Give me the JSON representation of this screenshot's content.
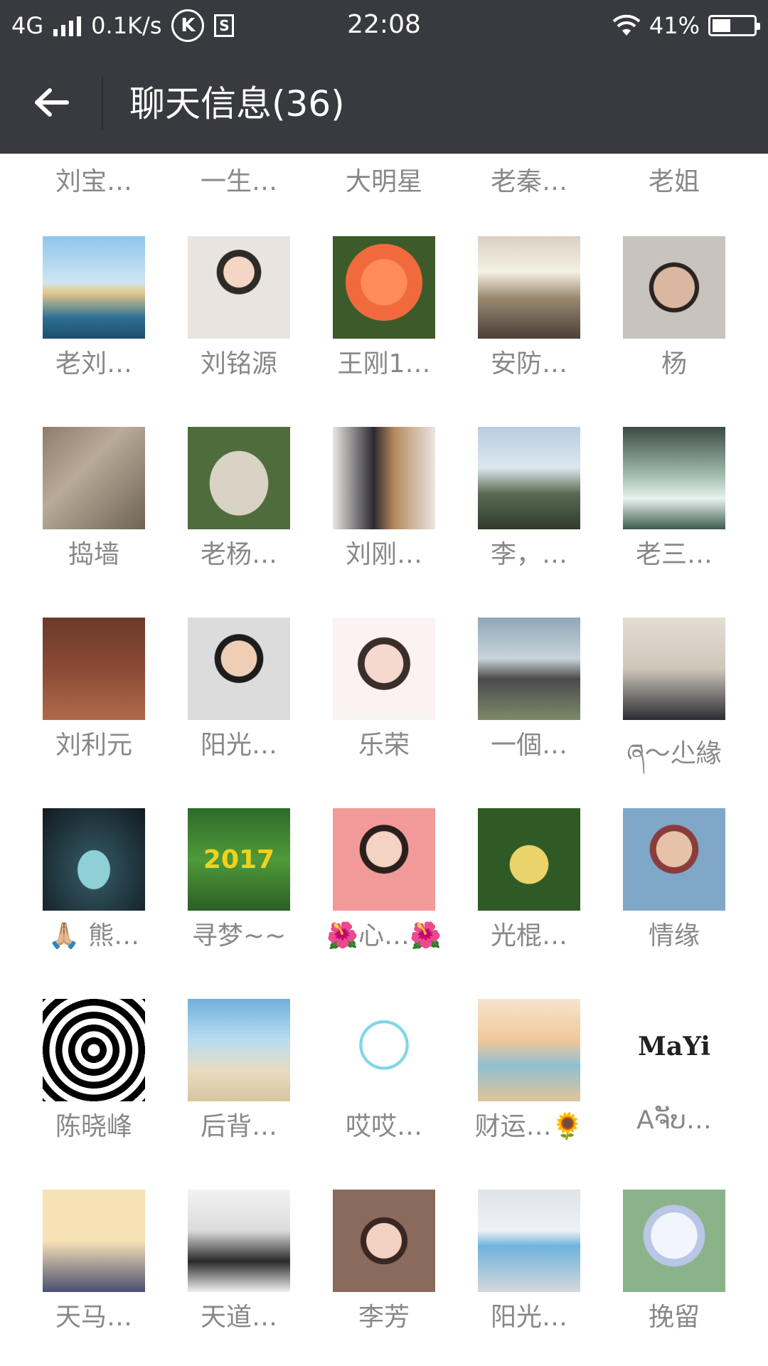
{
  "status_bar": {
    "network": "4G",
    "speed": "0.1K/s",
    "k_icon": "K",
    "s_icon": "S",
    "time": "22:08",
    "battery": "41%",
    "battery_level": 0.41
  },
  "header": {
    "back_icon": "arrow-left-icon",
    "title": "聊天信息(36)"
  },
  "members": [
    {
      "name": "刘宝…",
      "avatar": ""
    },
    {
      "name": "一生…",
      "avatar": ""
    },
    {
      "name": "大明星",
      "avatar": ""
    },
    {
      "name": "老秦…",
      "avatar": ""
    },
    {
      "name": "老姐",
      "avatar": ""
    },
    {
      "name": "老刘…",
      "avatar": "sailing-ship",
      "bg": "linear-gradient(#8fc6ec 0%,#cfe5f3 45%,#e6c98a 55%,#2a6f96 80%,#204e6a 100%)"
    },
    {
      "name": "刘铭源",
      "avatar": "person-photo",
      "bg": "radial-gradient(circle at 50% 35%,#f3d7c4 0 18%,#2d2a28 19% 26%,#e9e4df 27%)"
    },
    {
      "name": "王刚1…",
      "avatar": "orange-flower",
      "bg": "radial-gradient(circle at 50% 45%,#ff8a5a 0 30%,#f06a3e 31% 50%,#3c5a2a 51%)"
    },
    {
      "name": "安防…",
      "avatar": "office-room",
      "bg": "linear-gradient(#d9d2c3 0%,#f5f0e4 35%,#9b8a72 60%,#4a4038 100%)"
    },
    {
      "name": "杨",
      "avatar": "person-photo",
      "bg": "radial-gradient(circle at 50% 50%,#d9b7a1 0 28%,#2a2320 29% 34%,#c9c3bd 35%)"
    },
    {
      "name": "捣墙",
      "avatar": "rock",
      "bg": "linear-gradient(135deg,#8d7d6c,#b9ab98 40%,#6e6356 100%)"
    },
    {
      "name": "老杨…",
      "avatar": "stone-inscription",
      "bg": "radial-gradient(ellipse at 50% 55%,#d8d3c5 0 40%,#4f6c3d 41%)"
    },
    {
      "name": "刘刚…",
      "avatar": "person-photo",
      "bg": "linear-gradient(90deg,#e9e6e3 0%,#2c2b30 40%,#b7895e 60%,#e9e6e3 100%)"
    },
    {
      "name": "李，…",
      "avatar": "mountains",
      "bg": "linear-gradient(#b9cde3 0%,#dde6ef 40%,#5b6b52 65%,#2f3b2d 100%)"
    },
    {
      "name": "老三…",
      "avatar": "horse-waterfall",
      "bg": "linear-gradient(#3c4a44 0%,#a8c3b6 50%,#e9f2ee 70%,#3e5c4e 100%)"
    },
    {
      "name": "刘利元",
      "avatar": "person-photo",
      "bg": "linear-gradient(#6b3a2a 0%,#8a4a35 50%,#b06a4a 100%)"
    },
    {
      "name": "阳光…",
      "avatar": "person-photo",
      "bg": "radial-gradient(circle at 50% 40%,#f0cdb5 0 22%,#1c1c1c 23% 30%,#dcdcdc 31%)"
    },
    {
      "name": "乐荣",
      "avatar": "person-photo",
      "bg": "radial-gradient(circle at 50% 45%,#f6d9ce 0 25%,#3b2d2a 26% 34%,#fbf3f3 35%)"
    },
    {
      "name": "一個…",
      "avatar": "motorcycle",
      "bg": "linear-gradient(#8fa7b6 0%,#c9d4d9 40%,#4a4a4a 60%,#7d8a6a 100%)"
    },
    {
      "name": "ཞ〜尐緣",
      "avatar": "person-photo",
      "bg": "linear-gradient(#e4ddd3 0%,#cfc6ba 50%,#2b2b33 100%)"
    },
    {
      "name": "🙏🏼 熊…",
      "avatar": "spotlight",
      "bg": "radial-gradient(ellipse at 50% 60%,#8ed0d6 0 22%,#2e4d58 23%,#111a1e 100%)"
    },
    {
      "name": "寻梦~~",
      "avatar": "grass-2017",
      "bg": "linear-gradient(#2d6a2a 0%,#4f9a3a 50%,#2c5e25 100%)",
      "text": "2017"
    },
    {
      "name": "🌺心…🌺",
      "avatar": "person-photo",
      "bg": "radial-gradient(circle at 50% 40%,#f4d3c3 0 22%,#2a1f1c 23% 30%,#f29a9a 31%)"
    },
    {
      "name": "光棍…",
      "avatar": "buddha-fruit",
      "bg": "radial-gradient(circle at 50% 55%,#e9d36a 0 25%,#2f5a25 26%)"
    },
    {
      "name": "情缘",
      "avatar": "baby-photo",
      "bg": "radial-gradient(circle at 50% 40%,#e6c2a8 0 22%,#8a3b3b 23% 30%,#7fa7c8 31%)"
    },
    {
      "name": "陈晓峰",
      "avatar": "swirl",
      "bg": "repeating-radial-gradient(circle at 50% 50%,#ffffff 0 8px,#000000 9px 18px)"
    },
    {
      "name": "后背…",
      "avatar": "beach-person",
      "bg": "linear-gradient(#6fb0de 0%,#b9dcef 40%,#e9dcc2 70%,#d8c4a0 100%)"
    },
    {
      "name": "哎哎…",
      "avatar": "cartoon",
      "bg": "radial-gradient(circle at 50% 45%,#ffffff 0 28%,#7fd6e8 29% 32%,#ffffff 33%)"
    },
    {
      "name": "财运…🌻",
      "avatar": "sunset-beach",
      "bg": "linear-gradient(#f5e4cf 0%,#f2c89a 40%,#8fc0d1 65%,#e0c49a 100%)"
    },
    {
      "name": "Aຈັບ…",
      "avatar": "mayi-logo",
      "bg": "#ffffff",
      "text": "MaYi"
    },
    {
      "name": "天马…",
      "avatar": "anime",
      "bg": "linear-gradient(#f7e2b5 0%,#f7e2b5 50%,#4a4e73 100%)"
    },
    {
      "name": "天道…",
      "avatar": "ink-painting",
      "bg": "linear-gradient(#f2f2f2 0%,#dcdcdc 40%,#2a2a2a 70%,#f0f0f0 100%)"
    },
    {
      "name": "李芳",
      "avatar": "person-photo",
      "bg": "radial-gradient(circle at 50% 50%,#f3d2c3 0 24%,#3a2622 25% 32%,#8a6a5c 33%)"
    },
    {
      "name": "阳光…",
      "avatar": "sports-car",
      "bg": "linear-gradient(#dfe4ea 0%,#eef1f4 40%,#6fb3dc 55%,#d4d8dc 100%)"
    },
    {
      "name": "挽留",
      "avatar": "anime",
      "bg": "radial-gradient(circle at 50% 45%,#f2f5fb 0 30%,#b9c6e6 31% 40%,#8ab38a 41%)"
    }
  ]
}
